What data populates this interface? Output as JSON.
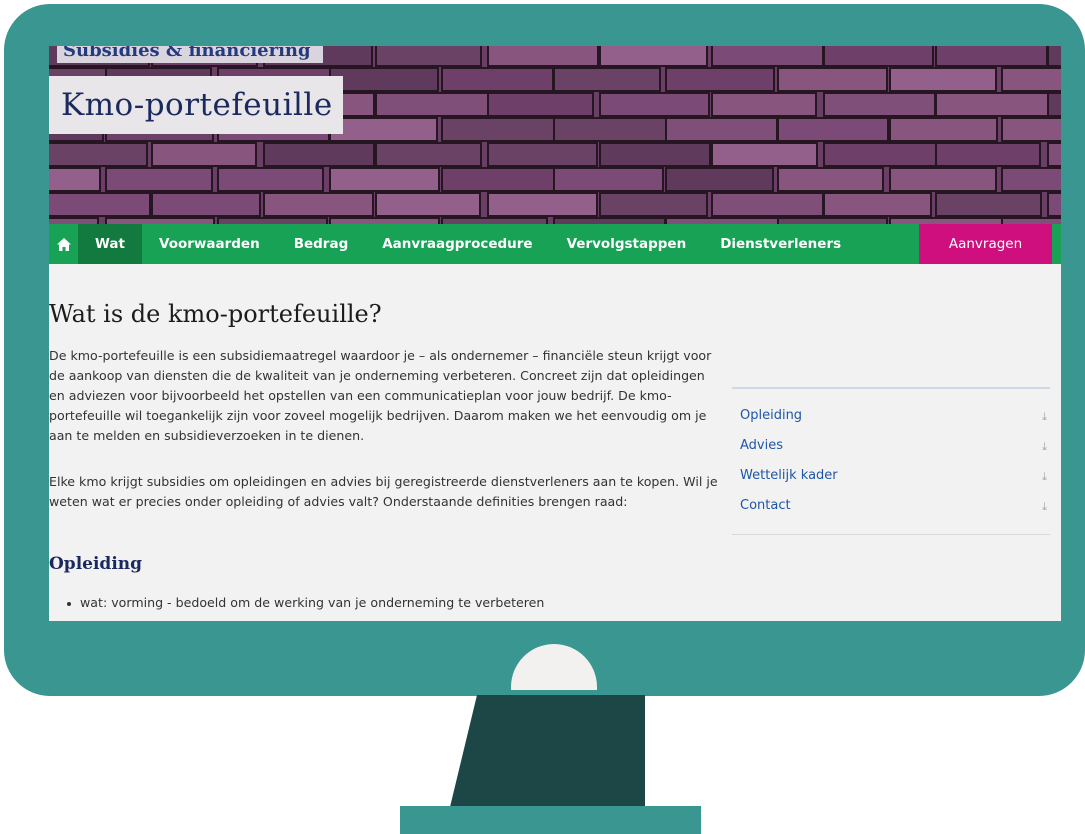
{
  "site": {
    "section_label": "Subsidies & financiering",
    "page_title": "Kmo-portefeuille"
  },
  "nav": {
    "home_icon": "home-icon",
    "items": [
      "Wat",
      "Voorwaarden",
      "Bedrag",
      "Aanvraagprocedure",
      "Vervolgstappen",
      "Dienstverleners"
    ],
    "active": "Wat",
    "cta": "Aanvragen"
  },
  "article": {
    "heading": "Wat is de kmo-portefeuille?",
    "paragraph1": "De kmo-portefeuille is een subsidiemaatregel waardoor je – als ondernemer – financiële steun krijgt voor de aankoop van diensten die de kwaliteit van je onderneming verbeteren. Concreet zijn dat opleidingen en adviezen voor bijvoorbeeld het opstellen van een communicatieplan voor jouw bedrijf. De kmo-portefeuille wil toegankelijk zijn voor zoveel mogelijk bedrijven. Daarom maken we het eenvoudig om je aan te melden en subsidieverzoeken in te dienen.",
    "paragraph2": "Elke kmo krijgt subsidies om opleidingen en advies bij geregistreerde dienstverleners aan te kopen. Wil je weten wat er precies onder opleiding of advies valt? Onderstaande definities brengen raad:",
    "section_title": "Opleiding",
    "bullets": [
      "wat: vorming - bedoeld om de werking van je onderneming te verbeteren"
    ]
  },
  "sidebar": {
    "links": [
      "Opleiding",
      "Advies",
      "Wettelijk kader",
      "Contact"
    ],
    "arrow_icon": "arrow-down-icon"
  },
  "colors": {
    "frame": "#3a9690",
    "stand": "#1c4746",
    "nav": "#17a255",
    "nav_active": "#137a3f",
    "cta": "#cf0f7d",
    "hero": "#6a3e66",
    "link": "#1e56a8"
  }
}
